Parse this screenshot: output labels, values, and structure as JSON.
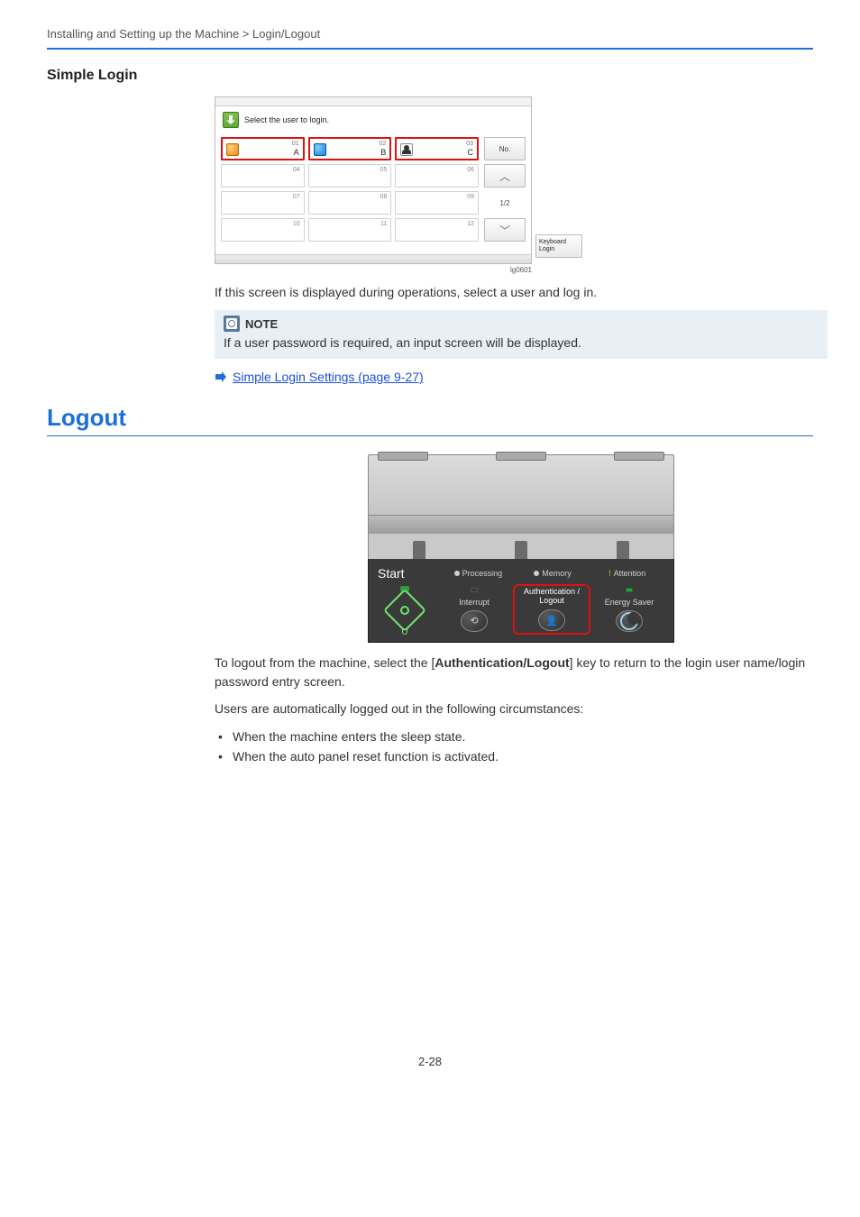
{
  "breadcrumb": "Installing and Setting up the Machine > Login/Logout",
  "section_title": "Simple Login",
  "login_panel": {
    "prompt": "Select the user to login.",
    "cells": [
      {
        "num": "01",
        "label": "A",
        "icon": "orange",
        "active": true
      },
      {
        "num": "02",
        "label": "B",
        "icon": "blue",
        "active": true
      },
      {
        "num": "03",
        "label": "C",
        "icon": "person",
        "active": true
      },
      {
        "num": "04",
        "label": "",
        "icon": "",
        "active": false
      },
      {
        "num": "05",
        "label": "",
        "icon": "",
        "active": false
      },
      {
        "num": "06",
        "label": "",
        "icon": "",
        "active": false
      },
      {
        "num": "07",
        "label": "",
        "icon": "",
        "active": false
      },
      {
        "num": "08",
        "label": "",
        "icon": "",
        "active": false
      },
      {
        "num": "09",
        "label": "",
        "icon": "",
        "active": false
      },
      {
        "num": "10",
        "label": "",
        "icon": "",
        "active": false
      },
      {
        "num": "11",
        "label": "",
        "icon": "",
        "active": false
      },
      {
        "num": "12",
        "label": "",
        "icon": "",
        "active": false
      }
    ],
    "no_btn": "No.",
    "page_indicator": "1/2",
    "keyboard_login": "Keyboard Login",
    "code": "lg0601"
  },
  "after_panel_text": "If this screen is displayed during operations, select a user and log in.",
  "note": {
    "label": "NOTE",
    "text": "If a user password is required, an input screen will be displayed."
  },
  "xref": "Simple Login Settings (page 9-27)",
  "logout_heading": "Logout",
  "control_panel": {
    "start": "Start",
    "processing": "Processing",
    "memory": "Memory",
    "attention": "Attention",
    "interrupt": "Interrupt",
    "auth": "Authentication / Logout",
    "energy": "Energy Saver"
  },
  "logout_text_1a": "To logout from the machine, select the [",
  "logout_text_1b": "Authentication/Logout",
  "logout_text_1c": "] key to return to the login user name/login password entry screen.",
  "logout_text_2": "Users are automatically logged out in the following circumstances:",
  "bullets": [
    "When the machine enters the sleep state.",
    "When the auto panel reset function is activated."
  ],
  "page_number": "2-28"
}
